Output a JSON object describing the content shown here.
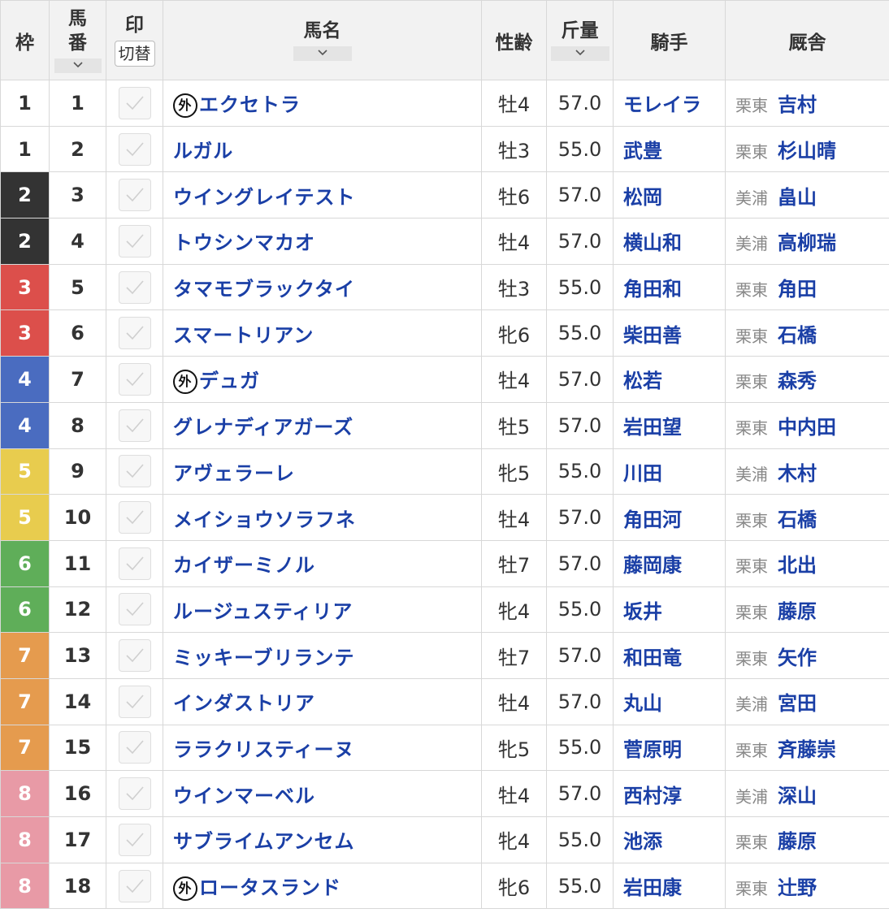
{
  "header": {
    "waku": "枠",
    "umaban_1": "馬",
    "umaban_2": "番",
    "mark": "印",
    "mark_toggle": "切替",
    "name": "馬名",
    "sexage": "性齢",
    "weight": "斤量",
    "jockey": "騎手",
    "stable": "厩舎"
  },
  "gai_label": "外",
  "waku_colors": {
    "1": {
      "bg": "#ffffff",
      "fg": "#333333"
    },
    "2": {
      "bg": "#333333",
      "fg": "#ffffff"
    },
    "3": {
      "bg": "#dc4f4b",
      "fg": "#ffffff"
    },
    "4": {
      "bg": "#4a6cc0",
      "fg": "#ffffff"
    },
    "5": {
      "bg": "#e8cc4e",
      "fg": "#ffffff"
    },
    "6": {
      "bg": "#5fae59",
      "fg": "#ffffff"
    },
    "7": {
      "bg": "#e59b4e",
      "fg": "#ffffff"
    },
    "8": {
      "bg": "#e89aa6",
      "fg": "#ffffff"
    }
  },
  "rows": [
    {
      "waku": "1",
      "num": "1",
      "gai": true,
      "name": "エクセトラ",
      "sexage": "牡4",
      "weight": "57.0",
      "jockey": "モレイラ",
      "loc": "栗東",
      "trainer": "吉村"
    },
    {
      "waku": "1",
      "num": "2",
      "gai": false,
      "name": "ルガル",
      "sexage": "牡3",
      "weight": "55.0",
      "jockey": "武豊",
      "loc": "栗東",
      "trainer": "杉山晴"
    },
    {
      "waku": "2",
      "num": "3",
      "gai": false,
      "name": "ウイングレイテスト",
      "sexage": "牡6",
      "weight": "57.0",
      "jockey": "松岡",
      "loc": "美浦",
      "trainer": "畠山"
    },
    {
      "waku": "2",
      "num": "4",
      "gai": false,
      "name": "トウシンマカオ",
      "sexage": "牡4",
      "weight": "57.0",
      "jockey": "横山和",
      "loc": "美浦",
      "trainer": "高柳瑞"
    },
    {
      "waku": "3",
      "num": "5",
      "gai": false,
      "name": "タマモブラックタイ",
      "sexage": "牡3",
      "weight": "55.0",
      "jockey": "角田和",
      "loc": "栗東",
      "trainer": "角田"
    },
    {
      "waku": "3",
      "num": "6",
      "gai": false,
      "name": "スマートリアン",
      "sexage": "牝6",
      "weight": "55.0",
      "jockey": "柴田善",
      "loc": "栗東",
      "trainer": "石橋"
    },
    {
      "waku": "4",
      "num": "7",
      "gai": true,
      "name": "デュガ",
      "sexage": "牡4",
      "weight": "57.0",
      "jockey": "松若",
      "loc": "栗東",
      "trainer": "森秀"
    },
    {
      "waku": "4",
      "num": "8",
      "gai": false,
      "name": "グレナディアガーズ",
      "sexage": "牡5",
      "weight": "57.0",
      "jockey": "岩田望",
      "loc": "栗東",
      "trainer": "中内田"
    },
    {
      "waku": "5",
      "num": "9",
      "gai": false,
      "name": "アヴェラーレ",
      "sexage": "牝5",
      "weight": "55.0",
      "jockey": "川田",
      "loc": "美浦",
      "trainer": "木村"
    },
    {
      "waku": "5",
      "num": "10",
      "gai": false,
      "name": "メイショウソラフネ",
      "sexage": "牡4",
      "weight": "57.0",
      "jockey": "角田河",
      "loc": "栗東",
      "trainer": "石橋"
    },
    {
      "waku": "6",
      "num": "11",
      "gai": false,
      "name": "カイザーミノル",
      "sexage": "牡7",
      "weight": "57.0",
      "jockey": "藤岡康",
      "loc": "栗東",
      "trainer": "北出"
    },
    {
      "waku": "6",
      "num": "12",
      "gai": false,
      "name": "ルージュスティリア",
      "sexage": "牝4",
      "weight": "55.0",
      "jockey": "坂井",
      "loc": "栗東",
      "trainer": "藤原"
    },
    {
      "waku": "7",
      "num": "13",
      "gai": false,
      "name": "ミッキーブリランテ",
      "sexage": "牡7",
      "weight": "57.0",
      "jockey": "和田竜",
      "loc": "栗東",
      "trainer": "矢作"
    },
    {
      "waku": "7",
      "num": "14",
      "gai": false,
      "name": "インダストリア",
      "sexage": "牡4",
      "weight": "57.0",
      "jockey": "丸山",
      "loc": "美浦",
      "trainer": "宮田"
    },
    {
      "waku": "7",
      "num": "15",
      "gai": false,
      "name": "ララクリスティーヌ",
      "sexage": "牝5",
      "weight": "55.0",
      "jockey": "菅原明",
      "loc": "栗東",
      "trainer": "斉藤崇"
    },
    {
      "waku": "8",
      "num": "16",
      "gai": false,
      "name": "ウインマーベル",
      "sexage": "牡4",
      "weight": "57.0",
      "jockey": "西村淳",
      "loc": "美浦",
      "trainer": "深山"
    },
    {
      "waku": "8",
      "num": "17",
      "gai": false,
      "name": "サブライムアンセム",
      "sexage": "牝4",
      "weight": "55.0",
      "jockey": "池添",
      "loc": "栗東",
      "trainer": "藤原"
    },
    {
      "waku": "8",
      "num": "18",
      "gai": true,
      "name": "ロータスランド",
      "sexage": "牝6",
      "weight": "55.0",
      "jockey": "岩田康",
      "loc": "栗東",
      "trainer": "辻野"
    }
  ]
}
